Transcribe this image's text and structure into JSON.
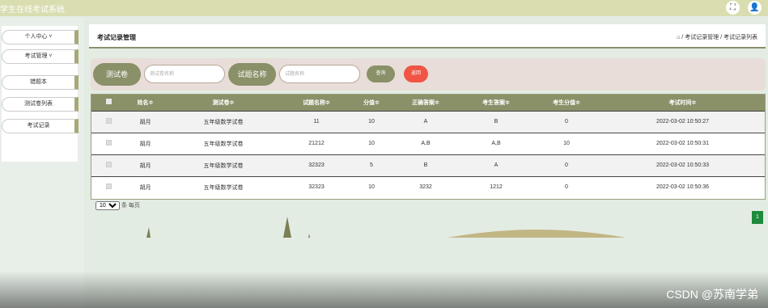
{
  "app": {
    "title": "学生在线考试系统"
  },
  "topbar": {
    "fullscreen_icon": "⛶",
    "user_icon": "👤"
  },
  "sidebar": {
    "items": [
      {
        "label": "个人中心 ˅"
      },
      {
        "label": "考试管理 ˅"
      },
      {
        "label": "错题本"
      },
      {
        "label": "测试卷列表"
      },
      {
        "label": "考试记录"
      }
    ]
  },
  "header": {
    "page_title": "考试记录管理",
    "breadcrumb": "⌂ / 考试记录管理 / 考试记录列表"
  },
  "search": {
    "paper_label": "测试卷",
    "paper_placeholder": "测试卷名称",
    "question_label": "试题名称",
    "question_placeholder": "试题名称",
    "search_button": "查询",
    "back_button": "返回",
    "search_color": "#8a9068",
    "back_color": "#f05545"
  },
  "table": {
    "headers": [
      "",
      "姓名≑",
      "测试卷≑",
      "试题名称≑",
      "分值≑",
      "正确答案≑",
      "考生答案≑",
      "考生分值≑",
      "考试时间≑"
    ],
    "rows": [
      [
        "胡月",
        "五年级数学试卷",
        "11",
        "10",
        "A",
        "B",
        "0",
        "2022-03-02 10:50:27"
      ],
      [
        "胡月",
        "五年级数学试卷",
        "21212",
        "10",
        "A,B",
        "A,B",
        "10",
        "2022-03-02 10:50:31"
      ],
      [
        "胡月",
        "五年级数学试卷",
        "32323",
        "5",
        "B",
        "A",
        "0",
        "2022-03-02 10:50:33"
      ],
      [
        "胡月",
        "五年级数学试卷",
        "32323",
        "10",
        "3232",
        "1212",
        "0",
        "2022-03-02 10:50:36"
      ]
    ]
  },
  "pager": {
    "page_size": "10",
    "per_page_text": "条 每页",
    "current_page": "1"
  },
  "watermark": "CSDN @苏南学弟"
}
